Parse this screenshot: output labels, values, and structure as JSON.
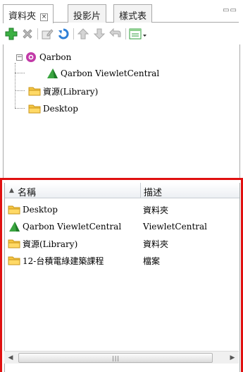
{
  "tabs": [
    {
      "label": "資料夾",
      "active": true,
      "has_close": true
    },
    {
      "label": "投影片",
      "active": false
    },
    {
      "label": "樣式表",
      "active": false
    }
  ],
  "window_controls": "▭▭",
  "toolbar": {
    "buttons": [
      {
        "name": "add",
        "icon": "green-plus-icon"
      },
      {
        "name": "delete",
        "icon": "gray-x-icon"
      },
      {
        "name": "edit",
        "icon": "edit-icon"
      },
      {
        "name": "refresh",
        "icon": "blue-refresh-icon"
      },
      {
        "name": "move-up",
        "icon": "up-arrow-icon"
      },
      {
        "name": "move-down",
        "icon": "down-arrow-icon"
      },
      {
        "name": "back",
        "icon": "back-arrow-icon"
      },
      {
        "name": "view-menu",
        "icon": "view-dropdown-icon"
      }
    ]
  },
  "tree": {
    "root": {
      "label": "Qarbon",
      "expander": "−"
    },
    "children": [
      {
        "label": "Qarbon ViewletCentral",
        "icon": "green-cone-icon"
      },
      {
        "label": "資源(Library)",
        "icon": "folder-icon"
      },
      {
        "label": "Desktop",
        "icon": "folder-icon"
      }
    ]
  },
  "list": {
    "sort_indicator": "▲",
    "columns": [
      "名稱",
      "描述"
    ],
    "rows": [
      {
        "name": "Desktop",
        "desc": "資料夾",
        "icon": "folder-icon"
      },
      {
        "name": "Qarbon ViewletCentral",
        "desc": "ViewletCentral",
        "icon": "green-cone-icon"
      },
      {
        "name": "資源(Library)",
        "desc": "資料夾",
        "icon": "folder-icon"
      },
      {
        "name": "12-台積電綠建築課程",
        "desc": "檔案",
        "icon": "folder-icon"
      }
    ]
  },
  "scrollbar": {
    "left_arrow": "◀",
    "right_arrow": "▶",
    "grip": "|||"
  },
  "colors": {
    "highlight_frame": "#e01010",
    "folder": "#f5c542",
    "accent_green": "#2e9e3a"
  }
}
